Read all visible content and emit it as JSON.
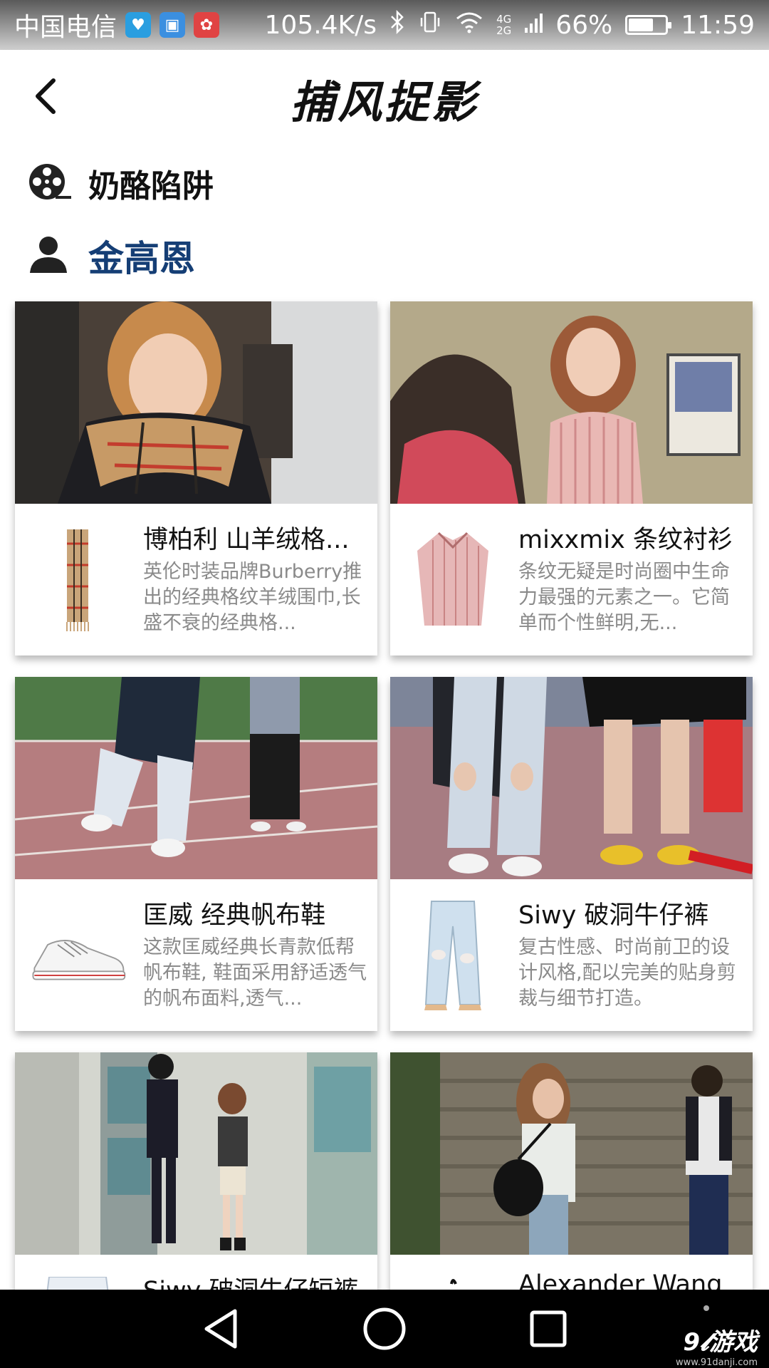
{
  "status_bar": {
    "carrier": "中国电信",
    "net_speed": "105.4K/s",
    "network_gen_top": "4G",
    "network_gen_bottom": "2G",
    "battery_text": "66%",
    "battery_level": 0.66,
    "time": "11:59",
    "app_icons": [
      "health-icon",
      "gallery-icon",
      "huawei-icon"
    ]
  },
  "header": {
    "title": "捕风捉影"
  },
  "movie": {
    "title": "奶酪陷阱"
  },
  "actor": {
    "name": "金高恩"
  },
  "cards": [
    {
      "title": "博柏利 山羊绒格...",
      "description": "英伦时装品牌Burberry推出的经典格纹羊绒围巾,长盛不衰的经典格..."
    },
    {
      "title": "mixxmix 条纹衬衫",
      "description": "条纹无疑是时尚圈中生命力最强的元素之一。它简单而个性鲜明,无..."
    },
    {
      "title": "匡威 经典帆布鞋",
      "description": "这款匡威经典长青款低帮帆布鞋, 鞋面采用舒适透气的帆布面料,透气..."
    },
    {
      "title": "Siwy 破洞牛仔裤",
      "description": "复古性感、时尚前卫的设计风格,配以完美的贴身剪裁与细节打造。"
    },
    {
      "title": "Siwy 破洞牛仔短裤",
      "description": ""
    },
    {
      "title": "Alexander Wang",
      "description": ""
    }
  ],
  "watermark": {
    "main": "9𝓵游戏",
    "sub": "www.91danji.com"
  },
  "colors": {
    "actor_name": "#153e75",
    "description_text": "#8a8a8a"
  }
}
